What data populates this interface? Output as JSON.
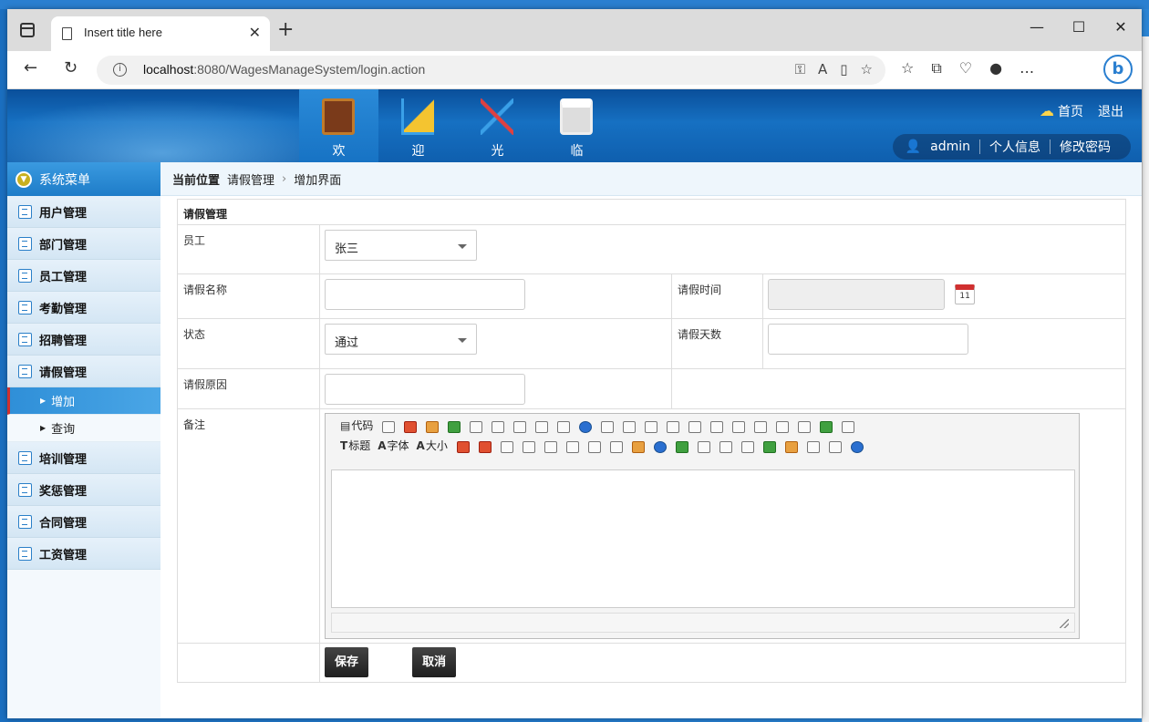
{
  "browser": {
    "tab_title": "Insert title here",
    "url_host": "localhost",
    "url_rest": ":8080/WagesManageSystem/login.action"
  },
  "header": {
    "modules": [
      {
        "label": "欢",
        "icon": "book-icon"
      },
      {
        "label": "迎",
        "icon": "ruler-icon"
      },
      {
        "label": "光",
        "icon": "tools-icon"
      },
      {
        "label": "临",
        "icon": "printer-icon"
      }
    ],
    "home": "首页",
    "logout": "退出",
    "user": "admin",
    "profile": "个人信息",
    "change_password": "修改密码"
  },
  "sidebar": {
    "title": "系统菜单",
    "items": [
      {
        "label": "用户管理"
      },
      {
        "label": "部门管理"
      },
      {
        "label": "员工管理"
      },
      {
        "label": "考勤管理"
      },
      {
        "label": "招聘管理"
      },
      {
        "label": "请假管理"
      },
      {
        "label": "培训管理"
      },
      {
        "label": "奖惩管理"
      },
      {
        "label": "合同管理"
      },
      {
        "label": "工资管理"
      }
    ],
    "sub_items": [
      {
        "label": "增加"
      },
      {
        "label": "查询"
      }
    ]
  },
  "breadcrumb": {
    "label": "当前位置",
    "level1": "请假管理",
    "level2": "增加界面"
  },
  "form": {
    "section_title": "请假管理",
    "employee_label": "员工",
    "employee_value": "张三",
    "leave_name_label": "请假名称",
    "leave_time_label": "请假时间",
    "calendar_day": "11",
    "status_label": "状态",
    "status_value": "通过",
    "leave_days_label": "请假天数",
    "reason_label": "请假原因",
    "remark_label": "备注",
    "save_label": "保存",
    "cancel_label": "取消"
  },
  "editor": {
    "code_label": "代码",
    "heading_label": "标题",
    "font_label": "字体",
    "size_label": "大小"
  }
}
